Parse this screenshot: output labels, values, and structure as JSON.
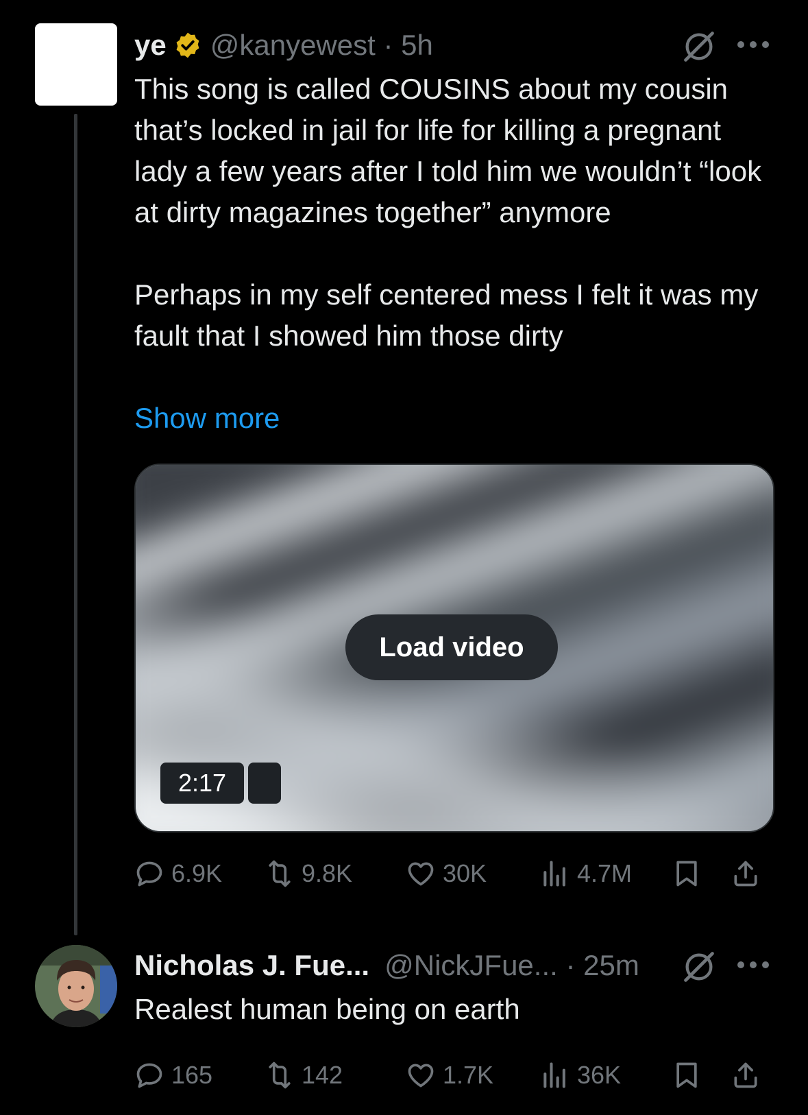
{
  "tweet": {
    "author_name": "ye",
    "handle": "@kanyewest",
    "separator": " · ",
    "time": "5h",
    "paragraphs": [
      "This song is called COUSINS about my cousin that’s locked in jail for life for killing a pregnant lady a few years after I told him we wouldn’t “look at dirty magazines together” anymore",
      "Perhaps in my self centered mess I felt it was my fault that I showed him those dirty"
    ],
    "show_more": "Show more",
    "media": {
      "load_video_label": "Load video",
      "duration": "2:17"
    },
    "stats": {
      "replies": "6.9K",
      "reposts": "9.8K",
      "likes": "30K",
      "views": "4.7M"
    }
  },
  "reply": {
    "author_name": "Nicholas J. Fue...",
    "handle": "@NickJFue...",
    "separator": " · ",
    "time": "25m",
    "text": "Realest human being on earth",
    "stats": {
      "replies": "165",
      "reposts": "142",
      "likes": "1.7K",
      "views": "36K"
    }
  },
  "colors": {
    "background": "#000000",
    "text": "#e7e9ea",
    "muted": "#71767b",
    "link": "#1d9bf0",
    "verified_badge": "#e2b719"
  },
  "icons": [
    "verified-badge-icon",
    "grok-icon",
    "more-icon",
    "reply-icon",
    "repost-icon",
    "like-icon",
    "views-icon",
    "bookmark-icon",
    "share-icon"
  ]
}
